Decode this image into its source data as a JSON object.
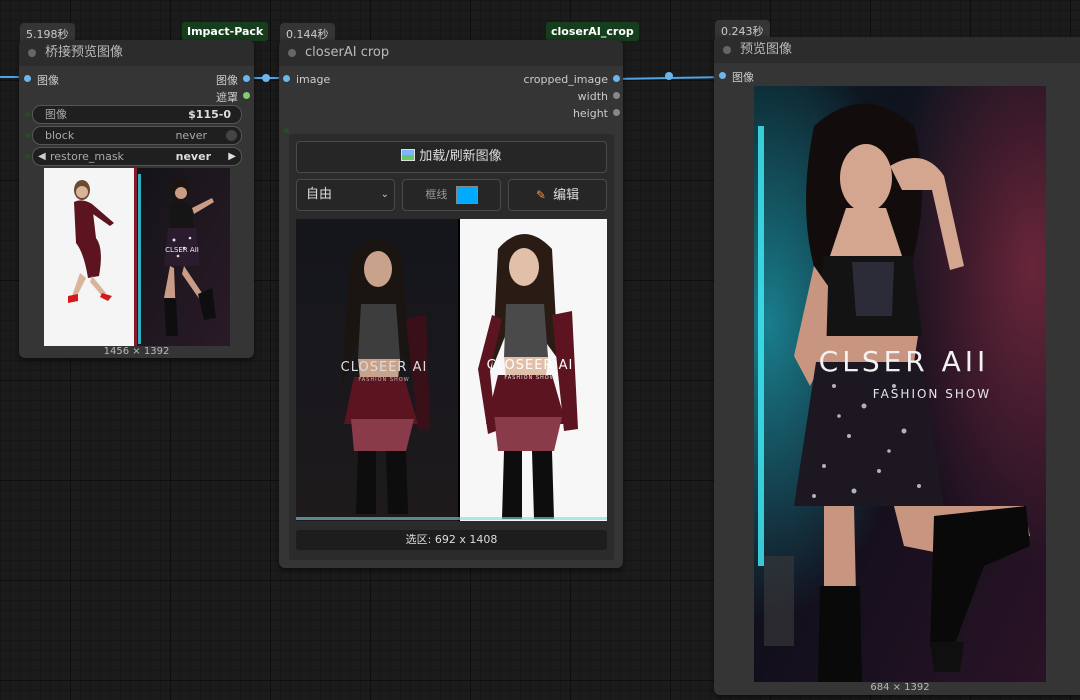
{
  "node1": {
    "time_badge": "5.198秒",
    "pack_tag": "Impact-Pack",
    "title": "桥接预览图像",
    "input_label": "图像",
    "outputs": [
      "图像",
      "遮罩"
    ],
    "widgets": {
      "image_label": "图像",
      "image_value": "$115-0",
      "block_label": "block",
      "block_value": "never",
      "restore_label": "restore_mask",
      "restore_value": "never"
    },
    "image_caption": "1456 × 1392"
  },
  "node2": {
    "time_badge": "0.144秒",
    "pack_tag": "closerAI_crop",
    "title": "closerAI crop",
    "input_label": "image",
    "outputs": [
      "cropped_image",
      "width",
      "height"
    ],
    "load_button": "加载/刷新图像",
    "ratio_select": "自由",
    "frame_label": "框线",
    "frame_color": "#00aaff",
    "edit_button": "编辑",
    "selection_text": "选区: 692 x 1408"
  },
  "node3": {
    "time_badge": "0.243秒",
    "title": "预览图像",
    "input_label": "图像",
    "image_caption": "684 × 1392",
    "overlay_brand": "CLSER AII",
    "overlay_sub": "FASHION SHOW"
  },
  "photo_overlay": {
    "brand": "CLOSEER AI",
    "sub": "FASHION SHOW"
  },
  "colors": {
    "wire": "#4fa3e6",
    "image_slot": "#6cb6ee",
    "mask_slot": "#7dcf6f"
  }
}
